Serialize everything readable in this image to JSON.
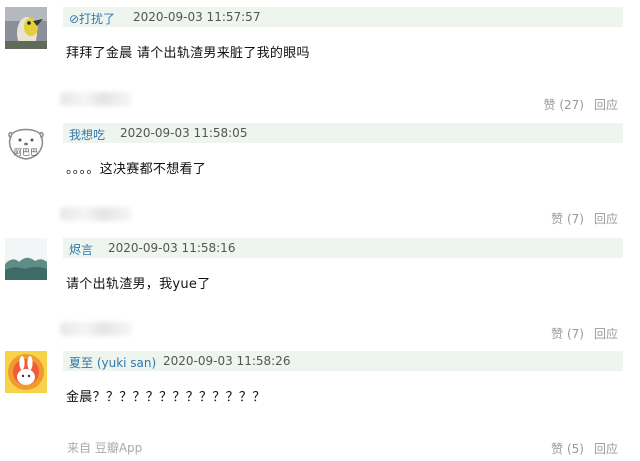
{
  "comments": [
    {
      "author": "⊘打扰了",
      "time": "2020-09-03 11:57:57",
      "content": "拜拜了金晨 请个出轨渣男来脏了我的眼吗",
      "source": "",
      "like": "赞 (27)",
      "reply": "回应",
      "avatar_icon": "parrot-avatar-icon"
    },
    {
      "author": "我想吃",
      "time": "2020-09-03 11:58:05",
      "content": "。。。。这决赛都不想看了",
      "source": "",
      "like": "赞 (7)",
      "reply": "回应",
      "avatar_icon": "bear-avatar-icon",
      "avatar_text": "阿巴巴"
    },
    {
      "author": "烬言",
      "time": "2020-09-03 11:58:16",
      "content": "请个出轨渣男，我yue了",
      "source": "",
      "like": "赞 (7)",
      "reply": "回应",
      "avatar_icon": "landscape-avatar-icon"
    },
    {
      "author": "夏至 (yuki san)",
      "time": "2020-09-03 11:58:26",
      "content": "金晨？？？？？？？？？？？？？",
      "source": "来自 豆瓣App",
      "like": "赞 (5)",
      "reply": "回应",
      "avatar_icon": "rabbit-sun-avatar-icon"
    }
  ],
  "colors": {
    "meta_bg": "#eef4ee",
    "author_link": "#3377aa",
    "muted": "#999999"
  }
}
